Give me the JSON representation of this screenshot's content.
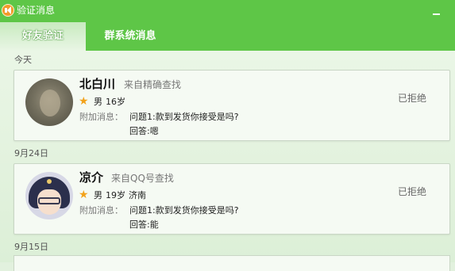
{
  "window": {
    "title": "验证消息"
  },
  "tabs": [
    {
      "label": "好友验证",
      "active": true
    },
    {
      "label": "群系统消息",
      "active": false
    }
  ],
  "groups": [
    {
      "date": "今天",
      "requests": [
        {
          "name": "北白川",
          "source": "来自精确查找",
          "gender": "男",
          "age": "16岁",
          "location": "",
          "extra_label": "附加消息：",
          "question": "问题1:款到发货你接受是吗?",
          "answer": "回答:嗯",
          "status": "已拒绝"
        }
      ]
    },
    {
      "date": "9月24日",
      "requests": [
        {
          "name": "凉介",
          "source": "来自QQ号查找",
          "gender": "男",
          "age": "19岁",
          "location": "济南",
          "extra_label": "附加消息：",
          "question": "问题1:款到发货你接受是吗?",
          "answer": "回答:能",
          "status": "已拒绝"
        }
      ]
    },
    {
      "date": "9月15日",
      "requests": []
    }
  ],
  "colors": {
    "titlebar": "#5ec647",
    "star": "#f2a21b"
  },
  "icons": {
    "app": "speaker-icon",
    "level": "star-icon"
  }
}
